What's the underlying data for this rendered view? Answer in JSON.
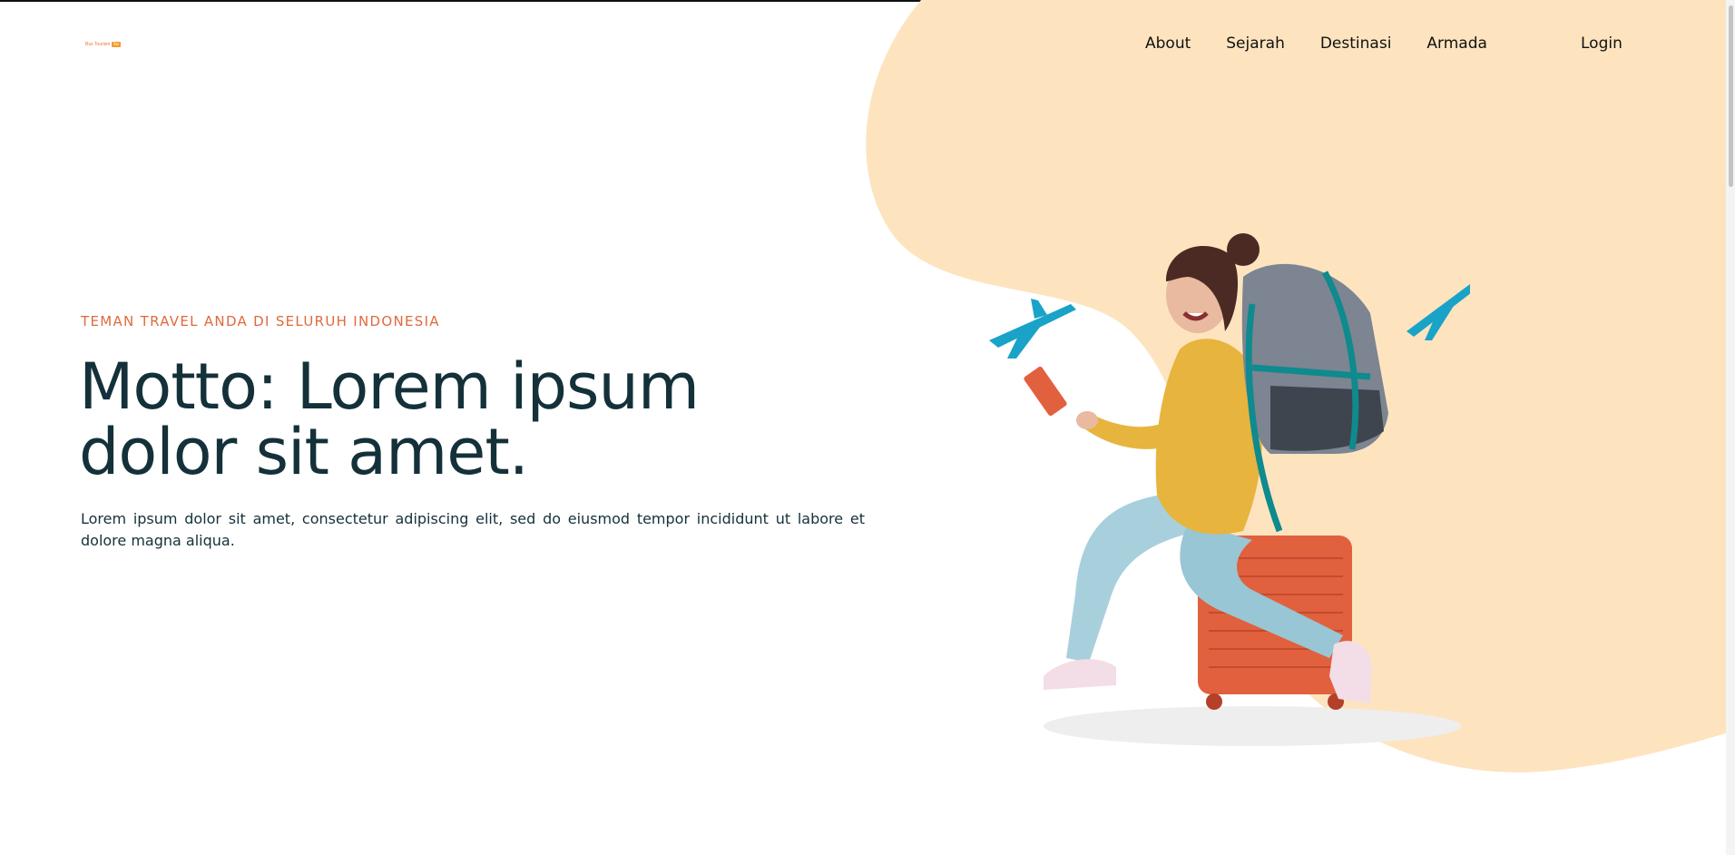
{
  "brand": {
    "name": "Bus Tourism",
    "badge": "ku",
    "accent_color": "#e8743b"
  },
  "nav": {
    "items": [
      {
        "label": "About"
      },
      {
        "label": "Sejarah"
      },
      {
        "label": "Destinasi"
      },
      {
        "label": "Armada"
      }
    ]
  },
  "login": {
    "label": "Login"
  },
  "hero": {
    "eyebrow": "TEMAN TRAVEL ANDA DI SELURUH INDONESIA",
    "title_line1": "Motto: Lorem ipsum",
    "title_line2": "dolor sit amet.",
    "description": "Lorem ipsum dolor sit amet, consectetur adipiscing elit, sed do eiusmod tempor incididunt ut labore et dolore magna aliqua.",
    "eyebrow_color": "#df6a3c",
    "title_color": "#14313a",
    "blob_color": "#fde4bf"
  }
}
